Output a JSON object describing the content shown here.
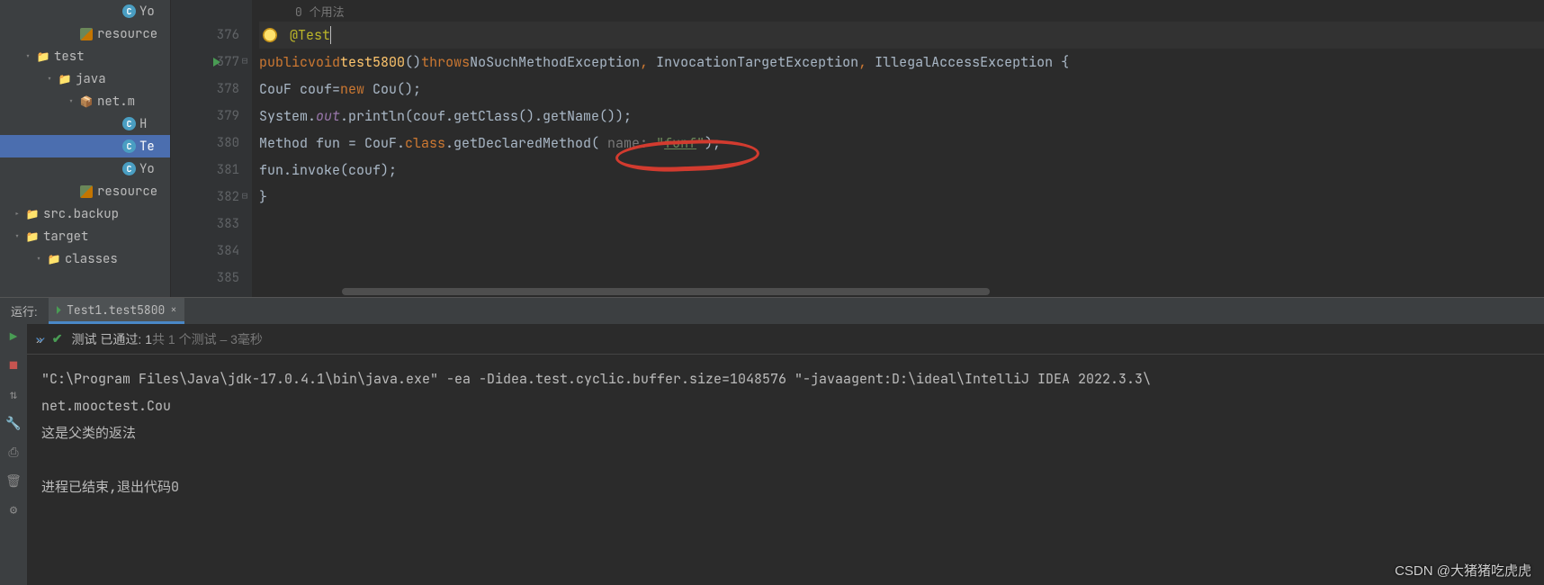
{
  "tree": {
    "rows": [
      {
        "indent": 120,
        "chevron": "none",
        "icon": "class",
        "label": "Yo"
      },
      {
        "indent": 72,
        "chevron": "none",
        "icon": "res",
        "label": "resource"
      },
      {
        "indent": 24,
        "chevron": "down",
        "icon": "folder-green",
        "label": "test"
      },
      {
        "indent": 48,
        "chevron": "down",
        "icon": "folder-green",
        "label": "java"
      },
      {
        "indent": 72,
        "chevron": "down",
        "icon": "pkg",
        "label": "net.m"
      },
      {
        "indent": 120,
        "chevron": "none",
        "icon": "class",
        "label": "H"
      },
      {
        "indent": 120,
        "chevron": "none",
        "icon": "class",
        "label": "Te",
        "selected": true
      },
      {
        "indent": 120,
        "chevron": "none",
        "icon": "class",
        "label": "Yo"
      },
      {
        "indent": 72,
        "chevron": "none",
        "icon": "res",
        "label": "resource"
      },
      {
        "indent": 12,
        "chevron": "right",
        "icon": "folder",
        "label": "src.backup"
      },
      {
        "indent": 12,
        "chevron": "down",
        "icon": "folder-orange",
        "label": "target"
      },
      {
        "indent": 36,
        "chevron": "down",
        "icon": "folder-orange",
        "label": "classes"
      }
    ]
  },
  "gutter": [
    "376",
    "377",
    "378",
    "379",
    "380",
    "381",
    "382",
    "383",
    "384",
    "385"
  ],
  "usage_hint": "0 个用法",
  "code": {
    "l1": {
      "annotation": "@Test"
    },
    "l2": {
      "kw_public": "public",
      "kw_void": "void",
      "method": "test5800",
      "paren": "()",
      "kw_throws": "throws",
      "ex1": "NoSuchMethodException",
      "c1": ", ",
      "ex2": "InvocationTargetException",
      "c2": ", ",
      "ex3": "IllegalAccessException",
      "brace": " {"
    },
    "l3": {
      "t1": "CouF couf=",
      "kw_new": "new",
      "t2": " Cou();"
    },
    "l4": {
      "t1": "System.",
      "out": "out",
      "t2": ".println(couf.getClass().getName());"
    },
    "l5": {
      "t1": "Method fun = CouF.",
      "kw_class": "class",
      "t2": ".getDeclaredMethod( ",
      "hint": "name:",
      "sp": " ",
      "str_open": "\"",
      "str": "funf",
      "str_close": "\"",
      "t3": ");"
    },
    "l6": {
      "t1": "fun.invoke(couf);"
    },
    "l7": {
      "brace": "}"
    }
  },
  "run": {
    "panel_label": "运行:",
    "tab": "Test1.test5800",
    "status_prefix": "测试 已通过:",
    "status_count": "1",
    "status_mid": "共 1 个测试",
    "status_time": "– 3毫秒",
    "console_cmd": "\"C:\\Program Files\\Java\\jdk-17.0.4.1\\bin\\java.exe\" -ea -Didea.test.cyclic.buffer.size=1048576 \"-javaagent:D:\\ideal\\IntelliJ IDEA 2022.3.3\\",
    "console_out1": "net.mooctest.Cou",
    "console_out2": "这是父类的返法",
    "console_exit": "进程已结束,退出代码0"
  },
  "watermark": "CSDN @大猪猪吃虎虎"
}
